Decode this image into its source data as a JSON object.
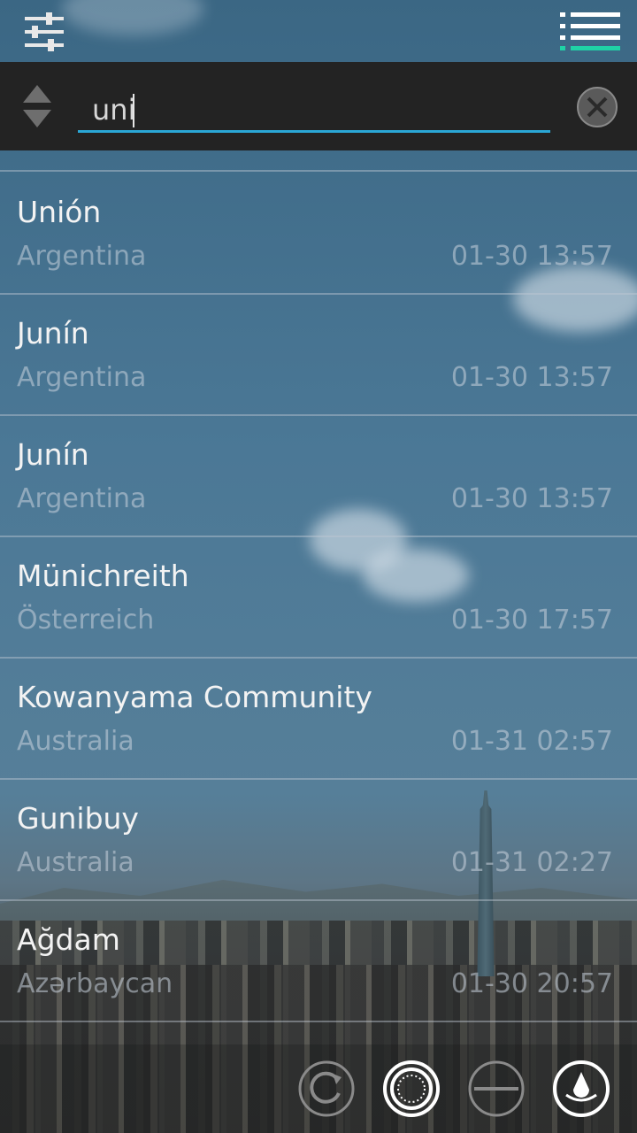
{
  "search": {
    "value": "uni"
  },
  "results": [
    {
      "city": "Unión",
      "country": "Argentina",
      "time": "01-30 13:57"
    },
    {
      "city": "Junín",
      "country": "Argentina",
      "time": "01-30 13:57"
    },
    {
      "city": "Junín",
      "country": "Argentina",
      "time": "01-30 13:57"
    },
    {
      "city": "Münichreith",
      "country": "Österreich",
      "time": "01-30 17:57"
    },
    {
      "city": "Kowanyama Community",
      "country": "Australia",
      "time": "01-31 02:57"
    },
    {
      "city": "Gunibuy",
      "country": "Australia",
      "time": "01-31 02:27"
    },
    {
      "city": "Ağdam",
      "country": "Azərbaycan",
      "time": "01-30 20:57"
    }
  ],
  "icons": {
    "settings": "sliders-icon",
    "menu": "list-menu-icon",
    "sort": "sort-arrows-icon",
    "clear": "close-circle-icon",
    "refresh": "refresh-icon",
    "clock_face": "dotted-circle-icon",
    "remove": "minus-circle-icon",
    "location": "location-icon"
  },
  "colors": {
    "accent": "#2aa7d6",
    "menu_accent": "#1fd3a6"
  }
}
